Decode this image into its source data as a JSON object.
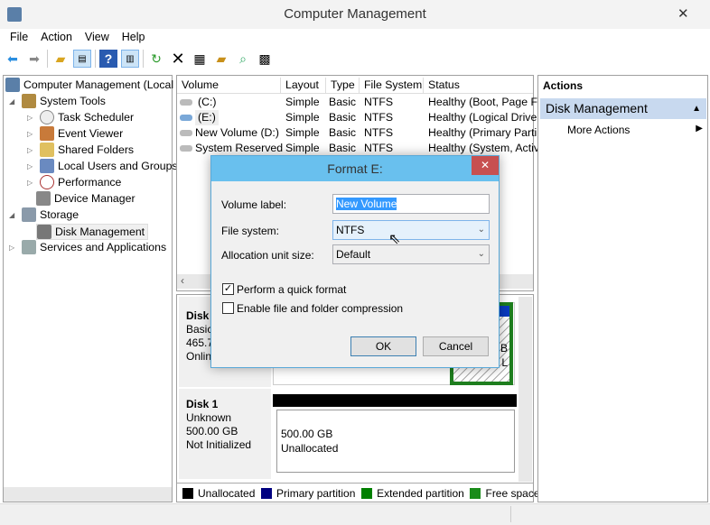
{
  "window": {
    "title": "Computer Management",
    "close": "✕"
  },
  "menu": [
    "File",
    "Action",
    "View",
    "Help"
  ],
  "toolbar_icons": [
    "back-arrow-icon",
    "forward-arrow-icon",
    "up-folder-icon",
    "show-hide-tree-icon",
    "help-icon",
    "show-action-pane-icon",
    "refresh-icon",
    "delete-icon",
    "properties-icon",
    "open-icon",
    "search-icon",
    "settings-icon"
  ],
  "tree": {
    "root": "Computer Management (Local",
    "items": [
      "System Tools",
      "Task Scheduler",
      "Event Viewer",
      "Shared Folders",
      "Local Users and Groups",
      "Performance",
      "Device Manager",
      "Storage",
      "Disk Management",
      "Services and Applications"
    ]
  },
  "volumes": {
    "columns": [
      "Volume",
      "Layout",
      "Type",
      "File System",
      "Status"
    ],
    "rows": [
      {
        "volume": "(C:)",
        "layout": "Simple",
        "type": "Basic",
        "fs": "NTFS",
        "status": "Healthy (Boot, Page Fi"
      },
      {
        "volume": "(E:)",
        "layout": "Simple",
        "type": "Basic",
        "fs": "NTFS",
        "status": "Healthy (Logical Drive"
      },
      {
        "volume": "New Volume (D:)",
        "layout": "Simple",
        "type": "Basic",
        "fs": "NTFS",
        "status": "Healthy (Primary Parti"
      },
      {
        "volume": "System Reserved",
        "layout": "Simple",
        "type": "Basic",
        "fs": "NTFS",
        "status": "Healthy (System, Activ"
      }
    ]
  },
  "disks": [
    {
      "name": "Disk 0",
      "type": "Basic",
      "size": "465.7",
      "state": "Online",
      "partial_b": "B",
      "partial_l": "L"
    },
    {
      "name": "Disk 1",
      "type": "Unknown",
      "size": "500.00 GB",
      "state": "Not Initialized",
      "part_size": "500.00 GB",
      "part_label": "Unallocated"
    }
  ],
  "legend": [
    {
      "label": "Unallocated",
      "color": "#000000"
    },
    {
      "label": "Primary partition",
      "color": "#000080"
    },
    {
      "label": "Extended partition",
      "color": "#008000"
    },
    {
      "label": "Free space",
      "color": "#1a8c1a"
    }
  ],
  "actions": {
    "header": "Actions",
    "section": "Disk Management",
    "item": "More Actions"
  },
  "dialog": {
    "title": "Format E:",
    "close": "✕",
    "volume_label": "Volume label:",
    "volume_value": "New Volume",
    "fs_label": "File system:",
    "fs_value": "NTFS",
    "alloc_label": "Allocation unit size:",
    "alloc_value": "Default",
    "quick": "Perform a quick format",
    "quick_checked": true,
    "compress": "Enable file and folder compression",
    "compress_checked": false,
    "ok": "OK",
    "cancel": "Cancel"
  }
}
